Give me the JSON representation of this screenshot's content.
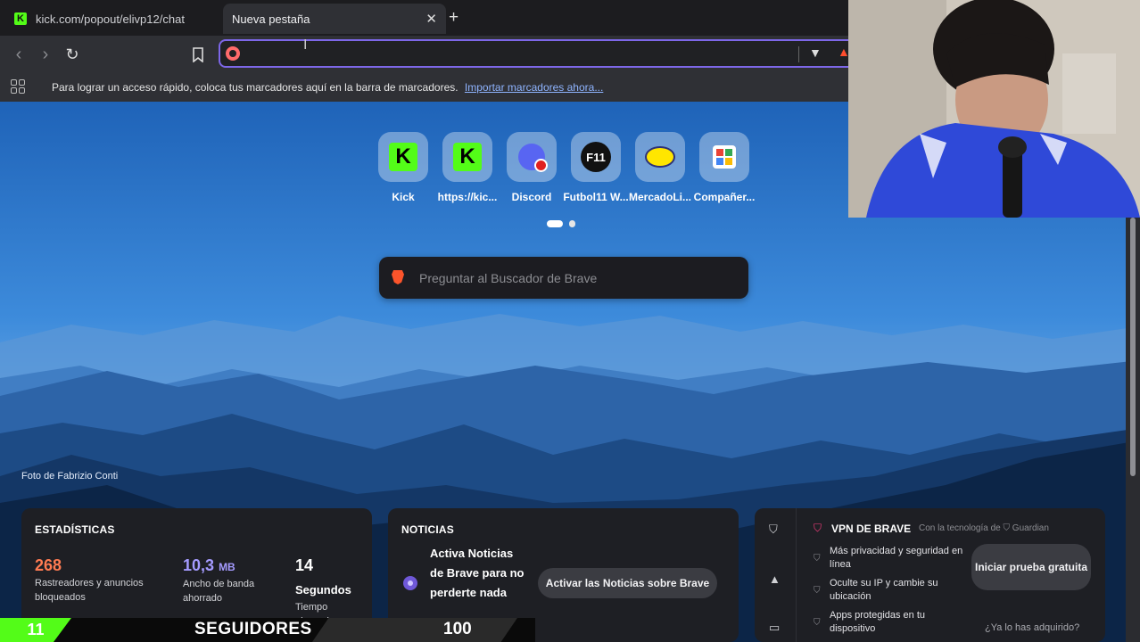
{
  "tabs": [
    {
      "title": "kick.com/popout/elivp12/chat",
      "active": false
    },
    {
      "title": "Nueva pestaña",
      "active": true
    }
  ],
  "toolbar": {
    "back": "back",
    "forward": "forward",
    "reload": "reload",
    "bookmark": "bookmark",
    "omnibox_value": ""
  },
  "bookmarks_bar": {
    "message": "Para lograr un acceso rápido, coloca tus marcadores aquí en la barra de marcadores.",
    "import_link": "Importar marcadores ahora..."
  },
  "top_sites": [
    {
      "label": "Kick",
      "icon": "kick-icon"
    },
    {
      "label": "https://kic...",
      "icon": "kick-icon"
    },
    {
      "label": "Discord",
      "icon": "discord-icon"
    },
    {
      "label": "Futbol11 W...",
      "icon": "futbol11-icon"
    },
    {
      "label": "MercadoLi...",
      "icon": "mercadolibre-icon"
    },
    {
      "label": "Compañer...",
      "icon": "calendar-icon"
    }
  ],
  "search": {
    "placeholder": "Preguntar al Buscador de Brave"
  },
  "photo_credit": "Foto de Fabrizio Conti",
  "stats": {
    "title": "ESTADÍSTICAS",
    "trackers": {
      "value": "268",
      "label": "Rastreadores y anuncios bloqueados"
    },
    "bandwidth": {
      "value": "10,3",
      "unit": "MB",
      "label": "Ancho de banda ahorrado"
    },
    "time": {
      "value": "14",
      "unit": "Segundos",
      "label": "Tiempo ahorrado"
    }
  },
  "news": {
    "title": "NOTICIAS",
    "text": "Activa Noticias de Brave para no perderte nada",
    "button": "Activar las Noticias sobre Brave"
  },
  "vpn": {
    "title": "VPN DE BRAVE",
    "powered": "Con la tecnología de",
    "powered_brand": "Guardian",
    "features": [
      "Más privacidad y seguridad en línea",
      "Oculte su IP y cambie su ubicación",
      "Apps protegidas en tu dispositivo"
    ],
    "trial_button": "Iniciar prueba gratuita",
    "purchased_link": "¿Ya lo has adquirido?"
  },
  "overlay": {
    "followers_count": "11",
    "followers_label": "SEGUIDORES",
    "followers_goal": "100"
  },
  "colors": {
    "accent": "#7d67e8",
    "kick_green": "#53fc18",
    "tracker_orange": "#ff7b52",
    "bandwidth_purple": "#a59bff"
  }
}
